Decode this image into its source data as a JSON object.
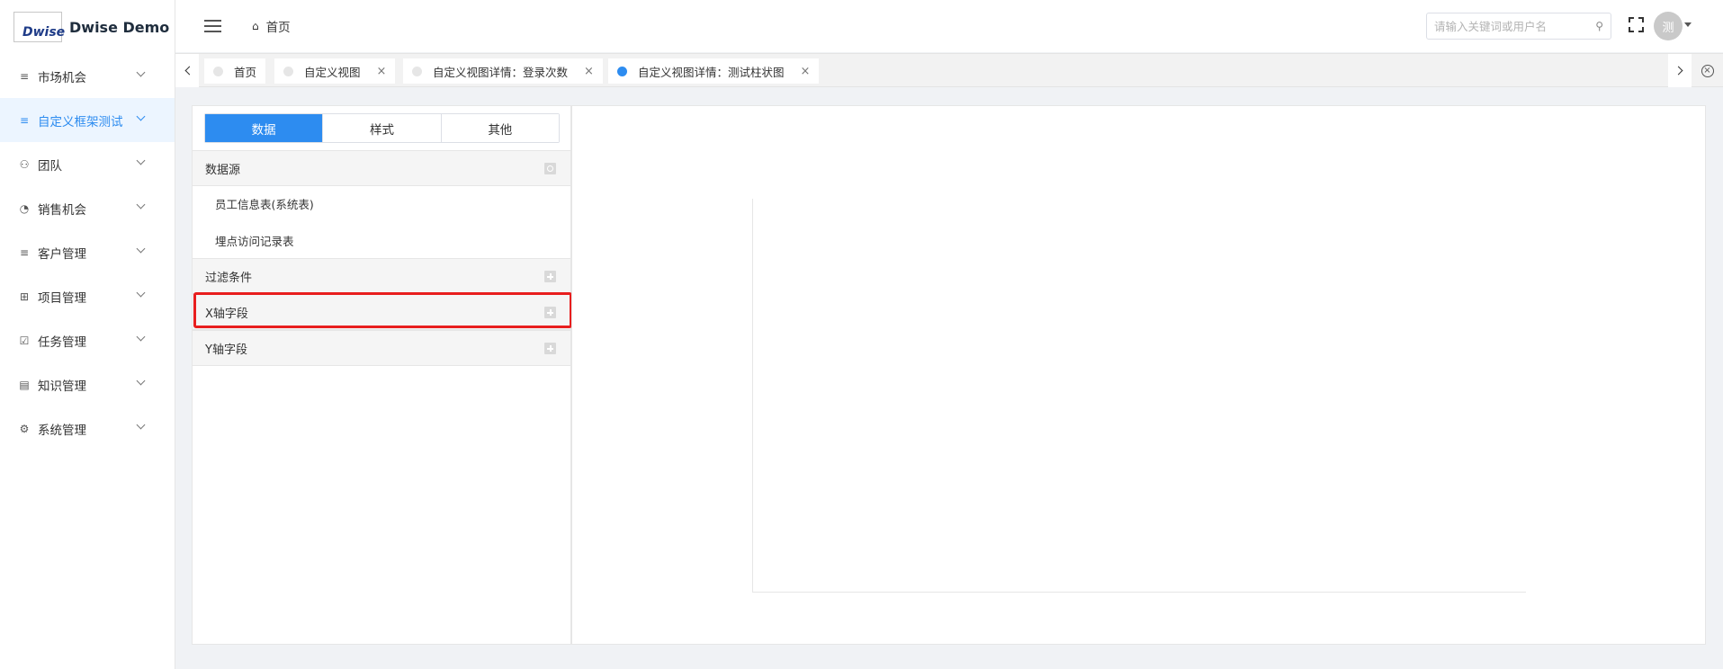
{
  "app": {
    "logo_text": "Dwise",
    "title": "Dwise Demo"
  },
  "sidebar": {
    "items": [
      {
        "label": "市场机会",
        "icon": "list-icon",
        "active": false
      },
      {
        "label": "自定义框架测试",
        "icon": "list-icon",
        "active": true
      },
      {
        "label": "团队",
        "icon": "team-icon",
        "active": false
      },
      {
        "label": "销售机会",
        "icon": "pie-icon",
        "active": false
      },
      {
        "label": "客户管理",
        "icon": "list-icon",
        "active": false
      },
      {
        "label": "项目管理",
        "icon": "grid-icon",
        "active": false
      },
      {
        "label": "任务管理",
        "icon": "checkbox-icon",
        "active": false
      },
      {
        "label": "知识管理",
        "icon": "book-icon",
        "active": false
      },
      {
        "label": "系统管理",
        "icon": "gear-icon",
        "active": false
      }
    ]
  },
  "header": {
    "breadcrumb": "首页",
    "search_placeholder": "请输入关键词或用户名",
    "avatar_text": "测"
  },
  "tabs": [
    {
      "label": "首页",
      "active": false,
      "closable": false
    },
    {
      "label": "自定义视图",
      "active": false,
      "closable": true
    },
    {
      "label": "自定义视图详情：登录次数",
      "active": false,
      "closable": true
    },
    {
      "label": "自定义视图详情：测试柱状图",
      "active": true,
      "closable": true
    }
  ],
  "editor": {
    "segments": [
      "数据",
      "样式",
      "其他"
    ],
    "active_segment": "数据",
    "sections": {
      "datasource": "数据源",
      "filter": "过滤条件",
      "x_axis": "X轴字段",
      "y_axis": "Y轴字段"
    },
    "datasources": [
      "员工信息表(系统表)",
      "埋点访问记录表"
    ]
  },
  "colors": {
    "accent": "#2d8cf0",
    "highlight": "#e81e1e"
  }
}
